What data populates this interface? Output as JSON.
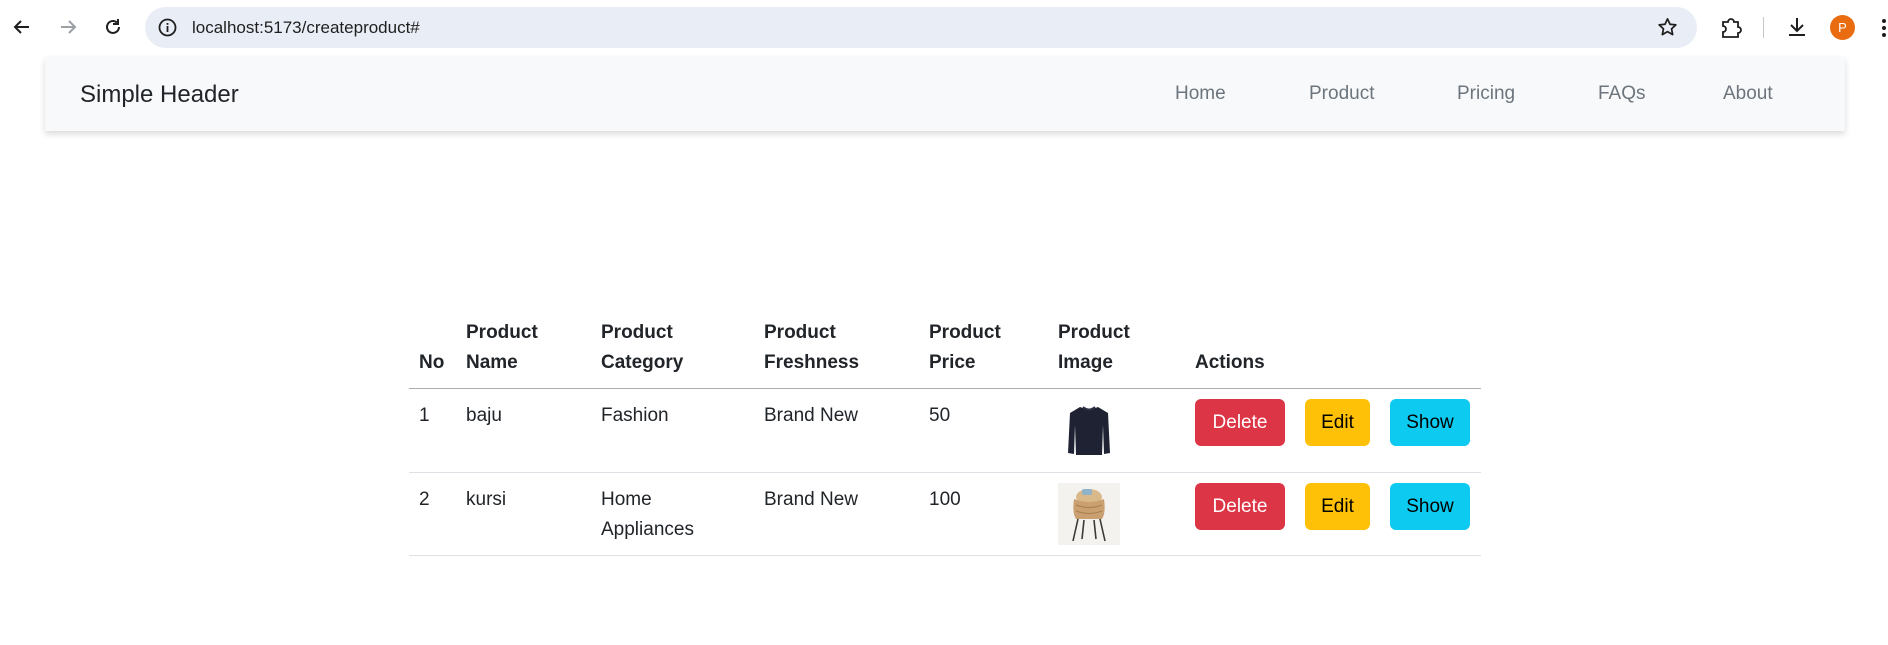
{
  "browser": {
    "url": "localhost:5173/createproduct#",
    "profile_initial": "P"
  },
  "header": {
    "brand": "Simple Header",
    "nav": [
      "Home",
      "Product",
      "Pricing",
      "FAQs",
      "About"
    ]
  },
  "table": {
    "columns": [
      "No",
      "Product Name",
      "Product Category",
      "Product Freshness",
      "Product Price",
      "Product Image",
      "Actions"
    ],
    "rows": [
      {
        "no": "1",
        "name": "baju",
        "category": "Fashion",
        "freshness": "Brand New",
        "price": "50",
        "image_icon": "sweater-image"
      },
      {
        "no": "2",
        "name": "kursi",
        "category": "Home Appliances",
        "freshness": "Brand New",
        "price": "100",
        "image_icon": "chair-image"
      }
    ],
    "actions": {
      "delete": "Delete",
      "edit": "Edit",
      "show": "Show"
    }
  },
  "colors": {
    "danger": "#dc3545",
    "warning": "#ffc107",
    "info": "#0dcaf0",
    "header_bg": "#f8f9fa",
    "omnibox_bg": "#e9eef6"
  }
}
